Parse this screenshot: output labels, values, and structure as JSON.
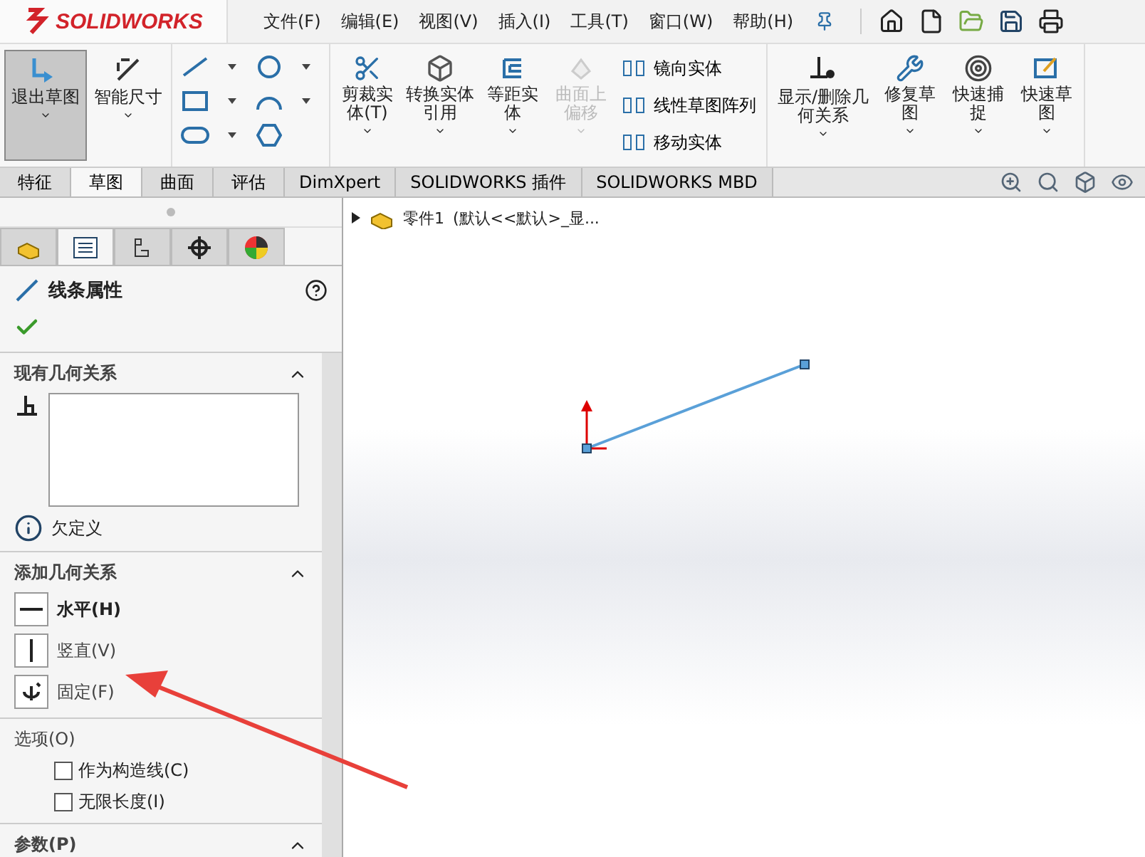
{
  "app": {
    "logo": "SOLIDWORKS"
  },
  "menu": [
    "文件(F)",
    "编辑(E)",
    "视图(V)",
    "插入(I)",
    "工具(T)",
    "窗口(W)",
    "帮助(H)"
  ],
  "ribbon": {
    "large_buttons": [
      {
        "label": "退出草图",
        "selected": true,
        "disabled": false,
        "kind": "exit"
      },
      {
        "label": "智能尺寸",
        "selected": false,
        "disabled": false,
        "kind": "dimension"
      }
    ],
    "group2": [
      {
        "label": "剪裁实体(T)",
        "selected": false,
        "disabled": false,
        "kind": "trim"
      },
      {
        "label": "转换实体引用",
        "selected": false,
        "disabled": false,
        "kind": "convert"
      },
      {
        "label": "等距实体",
        "selected": false,
        "disabled": false,
        "kind": "offset"
      },
      {
        "label": "曲面上偏移",
        "selected": false,
        "disabled": true,
        "kind": "surface"
      }
    ],
    "small_buttons": [
      "镜向实体",
      "线性草图阵列",
      "移动实体"
    ],
    "group3": [
      {
        "label": "显示/删除几何关系",
        "selected": false,
        "disabled": false,
        "kind": "relations"
      },
      {
        "label": "修复草图",
        "selected": false,
        "disabled": false,
        "kind": "repair"
      },
      {
        "label": "快速捕捉",
        "selected": false,
        "disabled": false,
        "kind": "snap"
      },
      {
        "label": "快速草图",
        "selected": false,
        "disabled": false,
        "kind": "quick"
      }
    ]
  },
  "command_tabs": [
    {
      "label": "特征",
      "selected": false
    },
    {
      "label": "草图",
      "selected": true
    },
    {
      "label": "曲面",
      "selected": false
    },
    {
      "label": "评估",
      "selected": false
    },
    {
      "label": "DimXpert",
      "selected": false
    },
    {
      "label": "SOLIDWORKS 插件",
      "selected": false
    },
    {
      "label": "SOLIDWORKS MBD",
      "selected": false
    }
  ],
  "panel_tabs": [
    {
      "kind": "feature",
      "selected": false
    },
    {
      "kind": "property",
      "selected": true
    },
    {
      "kind": "config",
      "selected": false
    },
    {
      "kind": "dimxpert",
      "selected": false
    },
    {
      "kind": "display",
      "selected": false
    }
  ],
  "property_manager": {
    "title": "线条属性",
    "existing_relations": {
      "title": "现有几何关系",
      "status": "欠定义"
    },
    "add_relations": {
      "title": "添加几何关系",
      "items": [
        {
          "label": "水平(H)",
          "kind": "horizontal",
          "selected": true
        },
        {
          "label": "竖直(V)",
          "kind": "vertical",
          "selected": false
        },
        {
          "label": "固定(F)",
          "kind": "fix",
          "selected": false
        }
      ]
    },
    "options": {
      "title": "选项(O)",
      "items": [
        {
          "label": "作为构造线(C)",
          "checked": false
        },
        {
          "label": "无限长度(I)",
          "checked": false
        }
      ]
    },
    "parameters": {
      "title": "参数(P)"
    }
  },
  "tree": {
    "label": "零件1",
    "config": "(默认<<默认>_显..."
  }
}
